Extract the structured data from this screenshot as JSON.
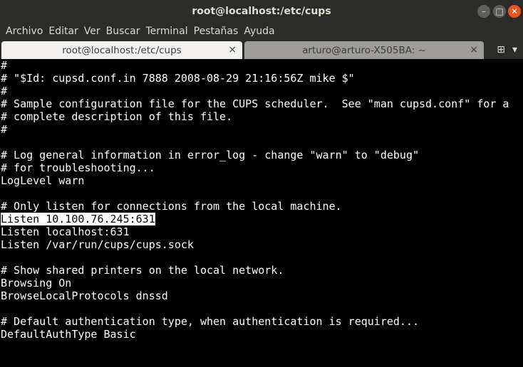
{
  "window": {
    "title": "root@localhost:/etc/cups",
    "btn_min": "–",
    "btn_max": "□",
    "btn_close": "✕"
  },
  "menu": [
    "Archivo",
    "Editar",
    "Ver",
    "Buscar",
    "Terminal",
    "Pestañas",
    "Ayuda"
  ],
  "tabs": [
    {
      "label": "root@localhost:/etc/cups",
      "close": "×"
    },
    {
      "label": "arturo@arturo-X505BA: ~",
      "close": "×"
    }
  ],
  "tab_actions": {
    "new_tab_icon": "⊞",
    "dropdown_icon": "▾"
  },
  "terminal": {
    "lines": [
      "#",
      "# \"$Id: cupsd.conf.in 7888 2008-08-29 21:16:56Z mike $\"",
      "#",
      "# Sample configuration file for the CUPS scheduler.  See \"man cupsd.conf\" for a",
      "# complete description of this file.",
      "#",
      "",
      "# Log general information in error_log - change \"warn\" to \"debug\"",
      "# for troubleshooting...",
      "LogLevel warn",
      "",
      "# Only listen for connections from the local machine.",
      "Listen 10.100.76.245:631",
      "Listen localhost:631",
      "Listen /var/run/cups/cups.sock",
      "",
      "# Show shared printers on the local network.",
      "Browsing On",
      "BrowseLocalProtocols dnssd",
      "",
      "# Default authentication type, when authentication is required...",
      "DefaultAuthType Basic"
    ],
    "selected_line_index": 12
  }
}
